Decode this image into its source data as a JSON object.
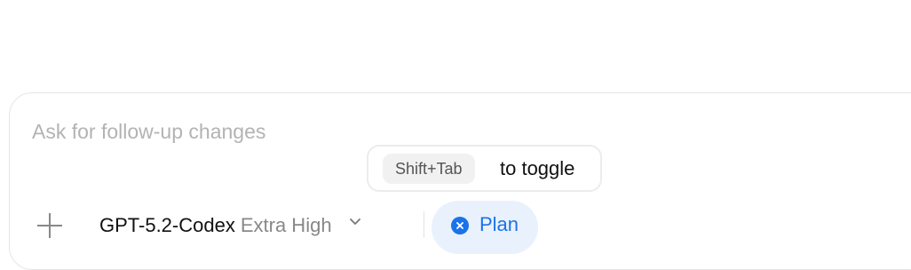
{
  "composer": {
    "placeholder": "Ask for follow-up changes"
  },
  "tooltip": {
    "shortcut": "Shift+Tab",
    "text": "to toggle"
  },
  "toolbar": {
    "add_icon": "plus-icon",
    "model_name": "GPT-5.2-Codex",
    "reasoning_effort": "Extra High",
    "model_chevron_icon": "chevron-down-icon",
    "plan_chip": {
      "icon": "close-circle-icon",
      "label": "Plan",
      "accent_color": "#1a73e8",
      "background_color": "#e9f1fd"
    }
  }
}
